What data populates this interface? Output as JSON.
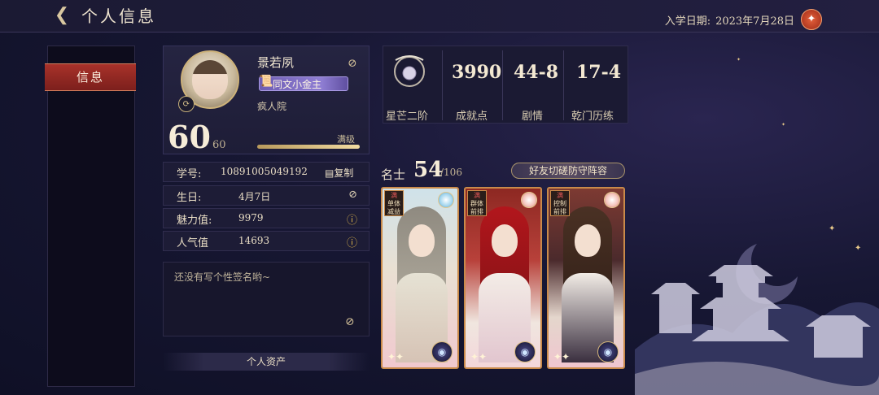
{
  "header": {
    "title": "个人信息",
    "enroll_label": "入学日期:",
    "enroll_date": "2023年7月28日"
  },
  "left_tabs": {
    "active": "信息"
  },
  "profile": {
    "name": "景若夙",
    "title_badge": "同文小金主",
    "academy": "疯人院",
    "level": "60",
    "level_max": "60",
    "level_status": "满级",
    "exp_fraction": 1.0
  },
  "info": {
    "id_label": "学号:",
    "id_value": "10891005049192",
    "copy_label": "复制",
    "birthday_label": "生日:",
    "birthday_value": "4月7日",
    "charm_label": "魅力值:",
    "charm_value": "9979",
    "popularity_label": "人气值",
    "popularity_value": "14693"
  },
  "signature": {
    "text": "还没有写个性签名哟~"
  },
  "assets_button": "个人资产",
  "stats": [
    {
      "value": "",
      "label": "星芒二阶"
    },
    {
      "value": "3990",
      "label": "成就点"
    },
    {
      "value": "44-8",
      "label": "剧情"
    },
    {
      "value": "17-4",
      "label": "乾门历练"
    }
  ],
  "roster": {
    "label": "名士",
    "count": "54",
    "total": "/106",
    "defense_button": "好友切磋防守阵容"
  },
  "cards": [
    {
      "badge_top": "满",
      "tag1": "单体",
      "tag2": "减益"
    },
    {
      "badge_top": "满",
      "tag1": "群体",
      "tag2": "前排"
    },
    {
      "badge_top": "满",
      "tag1": "控制",
      "tag2": "前排"
    }
  ],
  "colors": {
    "accent_red": "#a8322a",
    "gold": "#cdb27a",
    "background": "#171733"
  }
}
